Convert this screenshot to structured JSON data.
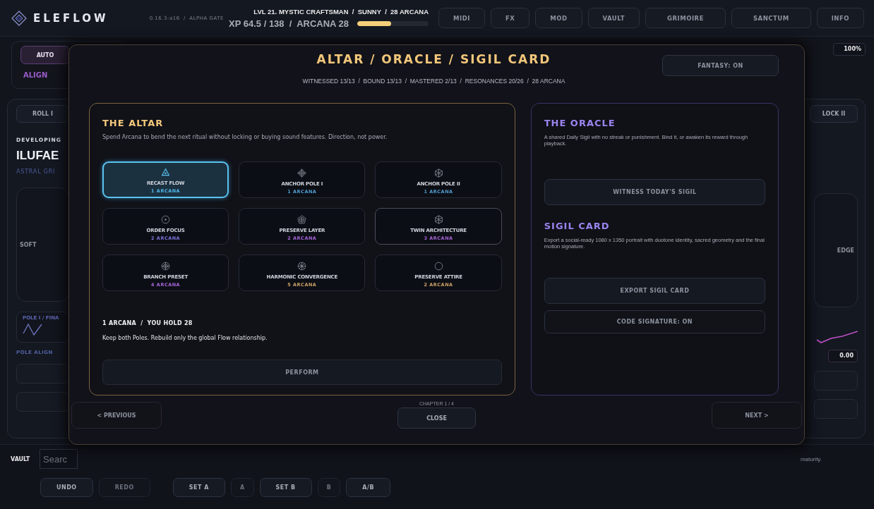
{
  "header": {
    "logo": "ELEFLOW",
    "version": "0.16.3-a16  /  ALPHA GATE",
    "status": "LVL 21. MYSTIC CRAFTSMAN  /  SUNNY  /  28 ARCANA",
    "xp": "XP 64.5 / 138  /  ARCANA 28",
    "xp_bar": {
      "level": 0.47
    },
    "nav": [
      "MIDI",
      "FX",
      "MOD",
      "VAULT",
      "GRIMOIRE",
      "SANCTUM",
      "INFO"
    ]
  },
  "toolbar": {
    "auto_button": "AUTO",
    "align_label": "ALIGN",
    "zoom_value": "100%"
  },
  "left_panel": {
    "roll_button": "ROLL I",
    "stage": "DEVELOPING",
    "name": "ILUFAE",
    "subtitle": "ASTRAL GRI",
    "dial_label": "SOFT",
    "curve_label": "POLE I / FINA",
    "param_label": "POLE ALIGN"
  },
  "right_panel": {
    "lock_button": "LOCK II",
    "dial_label": "EDGE",
    "param_value": "0.00"
  },
  "vault_bar": {
    "label": "VAULT",
    "search": {
      "placeholder": "Searc"
    },
    "note": "maturity.",
    "buttons": [
      {
        "label": "UNDO",
        "disabled": false
      },
      {
        "label": "REDO",
        "disabled": true
      },
      {
        "label": "SET A",
        "disabled": false
      },
      {
        "label": "A",
        "disabled": true
      },
      {
        "label": "SET B",
        "disabled": false
      },
      {
        "label": "B",
        "disabled": true
      },
      {
        "label": "A/B",
        "disabled": false
      }
    ]
  },
  "modal": {
    "title": "ALTAR / ORACLE / SIGIL CARD",
    "fantasy_button": "FANTASY: ON",
    "stats": "WITNESSED 13/13  /  BOUND 13/13  /  MASTERED 2/13  /  RESONANCES 20/26  /  28 ARCANA",
    "altar": {
      "title": "THE ALTAR",
      "description": "Spend Arcana to bend the next ritual without locking or buying sound features. Direction, not power.",
      "rites": [
        {
          "name": "RECAST FLOW",
          "cost": "1 ARCANA",
          "color": "#4fb3e6",
          "selected": true,
          "hovered": false
        },
        {
          "name": "ANCHOR POLE I",
          "cost": "1 ARCANA",
          "color": "#4f9cd0",
          "selected": false,
          "hovered": false
        },
        {
          "name": "ANCHOR POLE II",
          "cost": "1 ARCANA",
          "color": "#4f9cd0",
          "selected": false,
          "hovered": false
        },
        {
          "name": "ORDER FOCUS",
          "cost": "2 ARCANA",
          "color": "#7a72d8",
          "selected": false,
          "hovered": false
        },
        {
          "name": "PRESERVE LAYER",
          "cost": "2 ARCANA",
          "color": "#a463d6",
          "selected": false,
          "hovered": false
        },
        {
          "name": "TWIN ARCHITECTURE",
          "cost": "3 ARCANA",
          "color": "#a463d6",
          "selected": false,
          "hovered": true
        },
        {
          "name": "BRANCH PRESET",
          "cost": "4 ARCANA",
          "color": "#a463d6",
          "selected": false,
          "hovered": false
        },
        {
          "name": "HARMONIC CONVERGENCE",
          "cost": "5 ARCANA",
          "color": "#c9a066",
          "selected": false,
          "hovered": false
        },
        {
          "name": "PRESERVE ATTIRE",
          "cost": "2 ARCANA",
          "color": "#c9a066",
          "selected": false,
          "hovered": false
        }
      ],
      "summary": "1 ARCANA  /  YOU HOLD 28",
      "detail": "Keep both Poles. Rebuild only the global Flow relationship.",
      "perform_button": "PERFORM"
    },
    "oracle": {
      "title": "THE ORACLE",
      "description": "A shared Daily Sigil with no streak or punishment. Bind it, or awaken its reward through playback.",
      "witness_button": "WITNESS TODAY'S SIGIL"
    },
    "sigil": {
      "title": "SIGIL CARD",
      "description": "Export a social-ready 1080 x 1350 portrait with duotone identity, sacred geometry and the final motion signature.",
      "export_button": "EXPORT SIGIL CARD",
      "signature_button": "CODE SIGNATURE: ON"
    },
    "previous_button": "< PREVIOUS",
    "chapter": "CHAPTER 1 / 4",
    "close_button": "CLOSE",
    "next_button": "NEXT >"
  }
}
